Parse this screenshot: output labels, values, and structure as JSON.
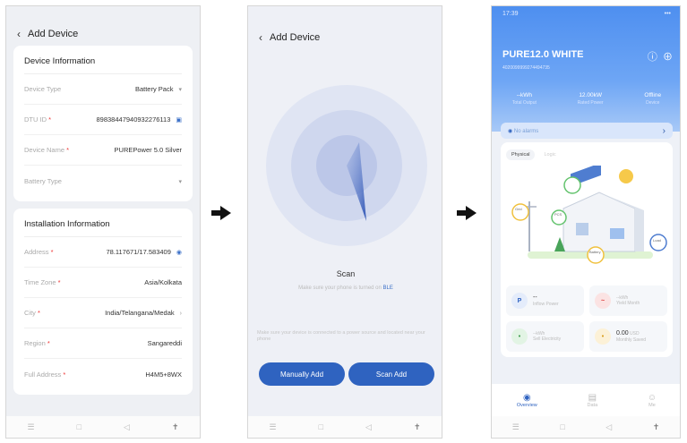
{
  "screen1": {
    "title": "Add Device",
    "device_info": {
      "heading": "Device Information",
      "rows": [
        {
          "label": "Device Type",
          "value": "Battery Pack",
          "required": false
        },
        {
          "label": "DTU ID",
          "value": "89838447940932276113",
          "required": true
        },
        {
          "label": "Device Name",
          "value": "PUREPower 5.0 Silver",
          "required": true
        },
        {
          "label": "Battery Type",
          "value": "",
          "required": false
        }
      ]
    },
    "install_info": {
      "heading": "Installation Information",
      "rows": [
        {
          "label": "Address",
          "value": "78.117671/17.583409",
          "required": true
        },
        {
          "label": "Time Zone",
          "value": "Asia/Kolkata",
          "required": true
        },
        {
          "label": "City",
          "value": "India/Telangana/Medak",
          "required": true
        },
        {
          "label": "Region",
          "value": "Sangareddi",
          "required": true
        },
        {
          "label": "Full Address",
          "value": "H4M5+8WX",
          "required": true
        }
      ]
    }
  },
  "screen2": {
    "title": "Add Device",
    "scan_title": "Scan",
    "scan_sub": "Make sure your phone is turned on",
    "scan_sub_ble": "BLE",
    "hint": "Make sure your device is connected to a power source and located near your phone",
    "manual_button": "Manually Add",
    "scan_button": "Scan Add"
  },
  "screen3": {
    "time": "17:39",
    "device_title": "PURE12.0 WHITE",
    "serial": "4020099999274494735",
    "stats": [
      {
        "value": "--kWh",
        "label": "Total Output"
      },
      {
        "value": "12.00kW",
        "label": "Rated Power"
      },
      {
        "value": "Offline",
        "label": "Device"
      }
    ],
    "alarm": "No alarms",
    "tabs": [
      "Physical",
      "Logic"
    ],
    "nodes": [
      "Grid",
      "PCS",
      "Battery",
      "Load"
    ],
    "tiles": [
      {
        "value": "--",
        "label": "Inflow Power"
      },
      {
        "value": "--kWh",
        "label": "Yield Month"
      },
      {
        "value": "--kWh",
        "label": "Sell Electricity"
      },
      {
        "value": "0.00",
        "unit": "USD",
        "label": "Monthly Saved"
      }
    ],
    "nav": [
      "Overview",
      "Data",
      "Me"
    ]
  },
  "colors": {
    "accent": "#2f63c0",
    "header": "#4e8ff0",
    "required": "#e33333"
  }
}
